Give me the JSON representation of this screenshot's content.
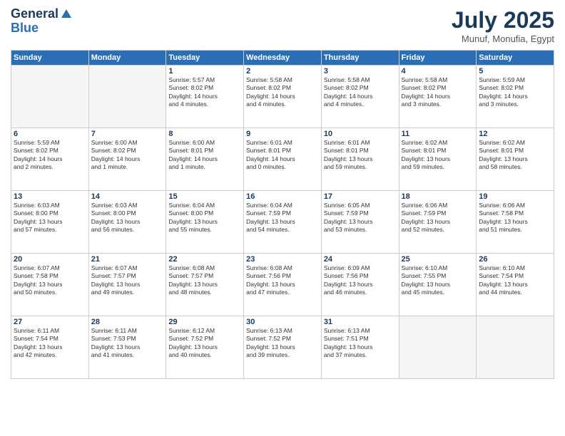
{
  "header": {
    "logo_line1": "General",
    "logo_line2": "Blue",
    "month_title": "July 2025",
    "location": "Munuf, Monufia, Egypt"
  },
  "days_of_week": [
    "Sunday",
    "Monday",
    "Tuesday",
    "Wednesday",
    "Thursday",
    "Friday",
    "Saturday"
  ],
  "weeks": [
    [
      {
        "day": "",
        "detail": ""
      },
      {
        "day": "",
        "detail": ""
      },
      {
        "day": "1",
        "detail": "Sunrise: 5:57 AM\nSunset: 8:02 PM\nDaylight: 14 hours\nand 4 minutes."
      },
      {
        "day": "2",
        "detail": "Sunrise: 5:58 AM\nSunset: 8:02 PM\nDaylight: 14 hours\nand 4 minutes."
      },
      {
        "day": "3",
        "detail": "Sunrise: 5:58 AM\nSunset: 8:02 PM\nDaylight: 14 hours\nand 4 minutes."
      },
      {
        "day": "4",
        "detail": "Sunrise: 5:58 AM\nSunset: 8:02 PM\nDaylight: 14 hours\nand 3 minutes."
      },
      {
        "day": "5",
        "detail": "Sunrise: 5:59 AM\nSunset: 8:02 PM\nDaylight: 14 hours\nand 3 minutes."
      }
    ],
    [
      {
        "day": "6",
        "detail": "Sunrise: 5:59 AM\nSunset: 8:02 PM\nDaylight: 14 hours\nand 2 minutes."
      },
      {
        "day": "7",
        "detail": "Sunrise: 6:00 AM\nSunset: 8:02 PM\nDaylight: 14 hours\nand 1 minute."
      },
      {
        "day": "8",
        "detail": "Sunrise: 6:00 AM\nSunset: 8:01 PM\nDaylight: 14 hours\nand 1 minute."
      },
      {
        "day": "9",
        "detail": "Sunrise: 6:01 AM\nSunset: 8:01 PM\nDaylight: 14 hours\nand 0 minutes."
      },
      {
        "day": "10",
        "detail": "Sunrise: 6:01 AM\nSunset: 8:01 PM\nDaylight: 13 hours\nand 59 minutes."
      },
      {
        "day": "11",
        "detail": "Sunrise: 6:02 AM\nSunset: 8:01 PM\nDaylight: 13 hours\nand 59 minutes."
      },
      {
        "day": "12",
        "detail": "Sunrise: 6:02 AM\nSunset: 8:01 PM\nDaylight: 13 hours\nand 58 minutes."
      }
    ],
    [
      {
        "day": "13",
        "detail": "Sunrise: 6:03 AM\nSunset: 8:00 PM\nDaylight: 13 hours\nand 57 minutes."
      },
      {
        "day": "14",
        "detail": "Sunrise: 6:03 AM\nSunset: 8:00 PM\nDaylight: 13 hours\nand 56 minutes."
      },
      {
        "day": "15",
        "detail": "Sunrise: 6:04 AM\nSunset: 8:00 PM\nDaylight: 13 hours\nand 55 minutes."
      },
      {
        "day": "16",
        "detail": "Sunrise: 6:04 AM\nSunset: 7:59 PM\nDaylight: 13 hours\nand 54 minutes."
      },
      {
        "day": "17",
        "detail": "Sunrise: 6:05 AM\nSunset: 7:59 PM\nDaylight: 13 hours\nand 53 minutes."
      },
      {
        "day": "18",
        "detail": "Sunrise: 6:06 AM\nSunset: 7:59 PM\nDaylight: 13 hours\nand 52 minutes."
      },
      {
        "day": "19",
        "detail": "Sunrise: 6:06 AM\nSunset: 7:58 PM\nDaylight: 13 hours\nand 51 minutes."
      }
    ],
    [
      {
        "day": "20",
        "detail": "Sunrise: 6:07 AM\nSunset: 7:58 PM\nDaylight: 13 hours\nand 50 minutes."
      },
      {
        "day": "21",
        "detail": "Sunrise: 6:07 AM\nSunset: 7:57 PM\nDaylight: 13 hours\nand 49 minutes."
      },
      {
        "day": "22",
        "detail": "Sunrise: 6:08 AM\nSunset: 7:57 PM\nDaylight: 13 hours\nand 48 minutes."
      },
      {
        "day": "23",
        "detail": "Sunrise: 6:08 AM\nSunset: 7:56 PM\nDaylight: 13 hours\nand 47 minutes."
      },
      {
        "day": "24",
        "detail": "Sunrise: 6:09 AM\nSunset: 7:56 PM\nDaylight: 13 hours\nand 46 minutes."
      },
      {
        "day": "25",
        "detail": "Sunrise: 6:10 AM\nSunset: 7:55 PM\nDaylight: 13 hours\nand 45 minutes."
      },
      {
        "day": "26",
        "detail": "Sunrise: 6:10 AM\nSunset: 7:54 PM\nDaylight: 13 hours\nand 44 minutes."
      }
    ],
    [
      {
        "day": "27",
        "detail": "Sunrise: 6:11 AM\nSunset: 7:54 PM\nDaylight: 13 hours\nand 42 minutes."
      },
      {
        "day": "28",
        "detail": "Sunrise: 6:11 AM\nSunset: 7:53 PM\nDaylight: 13 hours\nand 41 minutes."
      },
      {
        "day": "29",
        "detail": "Sunrise: 6:12 AM\nSunset: 7:52 PM\nDaylight: 13 hours\nand 40 minutes."
      },
      {
        "day": "30",
        "detail": "Sunrise: 6:13 AM\nSunset: 7:52 PM\nDaylight: 13 hours\nand 39 minutes."
      },
      {
        "day": "31",
        "detail": "Sunrise: 6:13 AM\nSunset: 7:51 PM\nDaylight: 13 hours\nand 37 minutes."
      },
      {
        "day": "",
        "detail": ""
      },
      {
        "day": "",
        "detail": ""
      }
    ]
  ]
}
